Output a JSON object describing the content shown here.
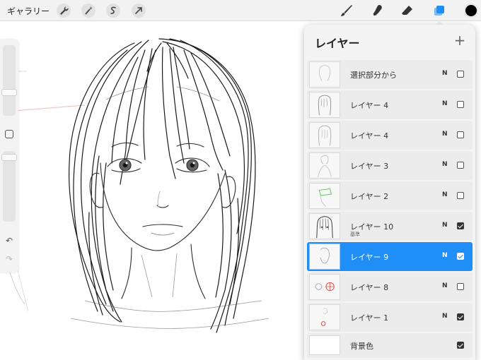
{
  "toolbar": {
    "gallery_label": "ギャラリー",
    "left_icons": [
      "wrench-icon",
      "magic-wand-icon",
      "selection-icon",
      "transform-arrow-icon"
    ],
    "right_icons": [
      "brush-icon",
      "smudge-icon",
      "eraser-icon",
      "layers-icon"
    ],
    "active_tool": "layers-icon",
    "current_color": "#000000",
    "accent_color": "#1f8ef7"
  },
  "sidebar": {
    "icons": [
      "brush-size-slider",
      "modify-square-icon",
      "opacity-slider",
      "undo-icon",
      "redo-icon"
    ]
  },
  "layers_panel": {
    "title": "レイヤー",
    "add_label": "+",
    "layers": [
      {
        "name": "選択部分から",
        "sub": "",
        "blend": "N",
        "visible": false,
        "active": false
      },
      {
        "name": "レイヤー 4",
        "sub": "",
        "blend": "N",
        "visible": false,
        "active": false
      },
      {
        "name": "レイヤー 4",
        "sub": "",
        "blend": "N",
        "visible": false,
        "active": false
      },
      {
        "name": "レイヤー 3",
        "sub": "",
        "blend": "N",
        "visible": false,
        "active": false
      },
      {
        "name": "レイヤー 2",
        "sub": "",
        "blend": "N",
        "visible": false,
        "active": false
      },
      {
        "name": "レイヤー 10",
        "sub": "基準",
        "blend": "N",
        "visible": true,
        "active": false
      },
      {
        "name": "レイヤー 9",
        "sub": "",
        "blend": "N",
        "visible": true,
        "active": true
      },
      {
        "name": "レイヤー 8",
        "sub": "",
        "blend": "N",
        "visible": false,
        "active": false
      },
      {
        "name": "レイヤー 1",
        "sub": "",
        "blend": "N",
        "visible": true,
        "active": false
      }
    ],
    "background": {
      "name": "背景色",
      "visible": true
    }
  }
}
